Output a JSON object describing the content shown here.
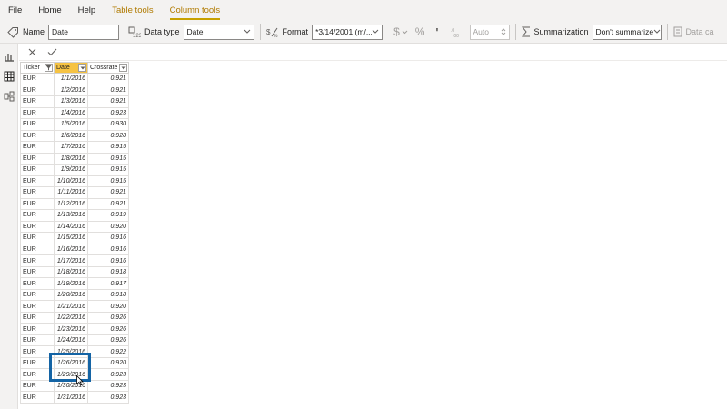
{
  "menu": {
    "tabs": [
      {
        "label": "File"
      },
      {
        "label": "Home"
      },
      {
        "label": "Help"
      },
      {
        "label": "Table tools"
      },
      {
        "label": "Column tools"
      }
    ]
  },
  "ribbon": {
    "name_label": "Name",
    "name_value": "Date",
    "datatype_label": "Data type",
    "datatype_value": "Date",
    "format_label": "Format",
    "format_value": "*3/14/2001 (m/...",
    "currency_symbol": "$",
    "percent_symbol": "%",
    "comma_symbol": "'",
    "decimals_value": "Auto",
    "summarization_label": "Summarization",
    "summarization_value": "Don't summarize",
    "datacategory_label": "Data ca"
  },
  "table": {
    "headers": [
      "Ticker",
      "Date",
      "Crossrate"
    ],
    "rows": [
      [
        "EUR",
        "1/1/2016",
        "0.921"
      ],
      [
        "EUR",
        "1/2/2016",
        "0.921"
      ],
      [
        "EUR",
        "1/3/2016",
        "0.921"
      ],
      [
        "EUR",
        "1/4/2016",
        "0.923"
      ],
      [
        "EUR",
        "1/5/2016",
        "0.930"
      ],
      [
        "EUR",
        "1/6/2016",
        "0.928"
      ],
      [
        "EUR",
        "1/7/2016",
        "0.915"
      ],
      [
        "EUR",
        "1/8/2016",
        "0.915"
      ],
      [
        "EUR",
        "1/9/2016",
        "0.915"
      ],
      [
        "EUR",
        "1/10/2016",
        "0.915"
      ],
      [
        "EUR",
        "1/11/2016",
        "0.921"
      ],
      [
        "EUR",
        "1/12/2016",
        "0.921"
      ],
      [
        "EUR",
        "1/13/2016",
        "0.919"
      ],
      [
        "EUR",
        "1/14/2016",
        "0.920"
      ],
      [
        "EUR",
        "1/15/2016",
        "0.916"
      ],
      [
        "EUR",
        "1/16/2016",
        "0.916"
      ],
      [
        "EUR",
        "1/17/2016",
        "0.916"
      ],
      [
        "EUR",
        "1/18/2016",
        "0.918"
      ],
      [
        "EUR",
        "1/19/2016",
        "0.917"
      ],
      [
        "EUR",
        "1/20/2016",
        "0.918"
      ],
      [
        "EUR",
        "1/21/2016",
        "0.920"
      ],
      [
        "EUR",
        "1/22/2016",
        "0.926"
      ],
      [
        "EUR",
        "1/23/2016",
        "0.926"
      ],
      [
        "EUR",
        "1/24/2016",
        "0.926"
      ],
      [
        "EUR",
        "1/25/2016",
        "0.922"
      ],
      [
        "EUR",
        "1/26/2016",
        "0.920"
      ],
      [
        "EUR",
        "1/29/2016",
        "0.923"
      ],
      [
        "EUR",
        "1/30/2016",
        "0.923"
      ],
      [
        "EUR",
        "1/31/2016",
        "0.923"
      ]
    ]
  },
  "colors": {
    "accent": "#c8a100",
    "selected_header": "#f6c343",
    "highlight_box": "#1464a5"
  }
}
